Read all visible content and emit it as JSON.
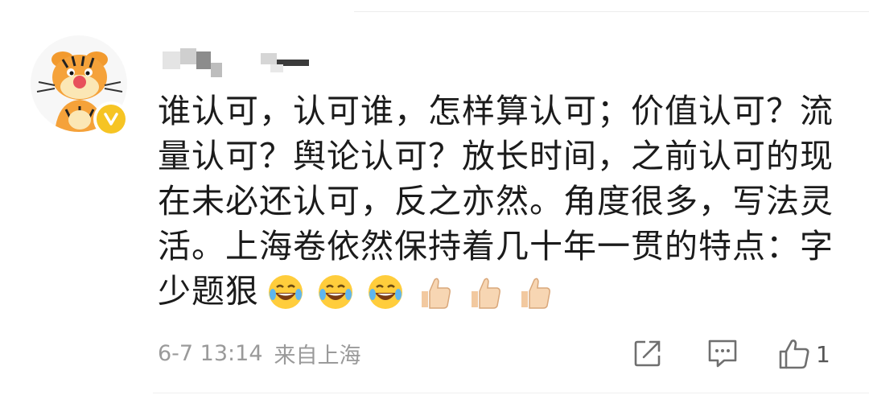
{
  "comment": {
    "text": "谁认可，认可谁，怎样算认可；价值认可？流量认可？舆论认可？放长时间，之前认可的现在未必还认可，反之亦然。角度很多，写法灵活。上海卷依然保持着几十年一贯的特点：字少题狠",
    "emojis": [
      "laugh-cry-emoji",
      "laugh-cry-emoji",
      "laugh-cry-emoji",
      "thumbs-up-emoji",
      "thumbs-up-emoji",
      "thumbs-up-emoji"
    ]
  },
  "meta": {
    "timestamp": "6-7 13:14",
    "location": "来自上海"
  },
  "actions": {
    "share_icon": "share-icon",
    "comment_icon": "comment-icon",
    "like_icon": "like-icon",
    "like_count": "1"
  },
  "colors": {
    "text": "#1b1b1b",
    "meta": "#9a9a9a",
    "verified": "#f6c423",
    "icon": "#6f6f6f"
  }
}
